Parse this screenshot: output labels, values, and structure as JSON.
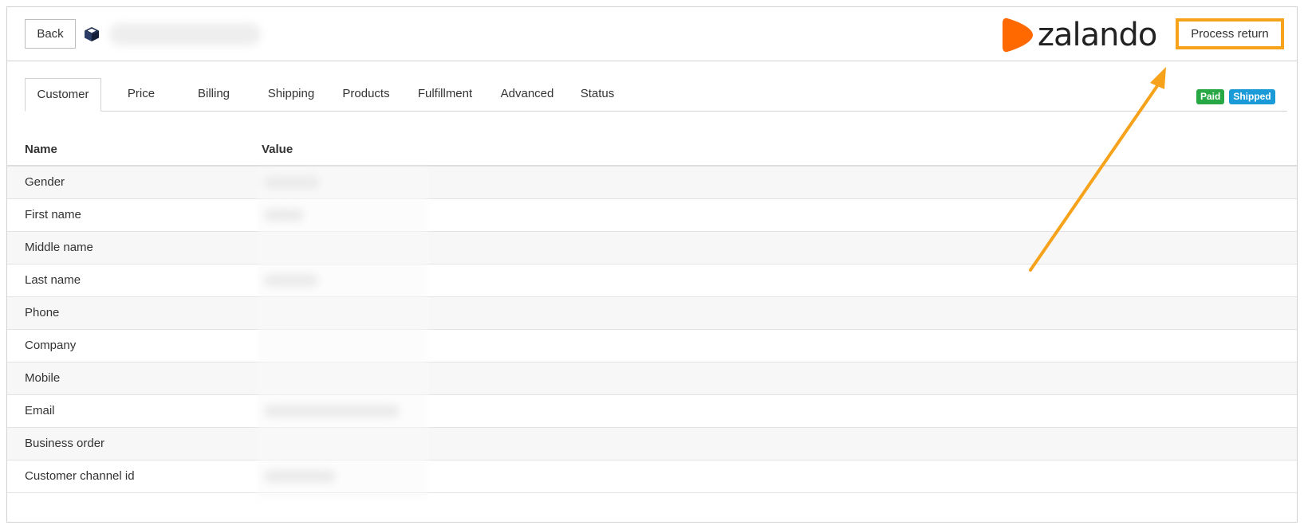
{
  "header": {
    "back_label": "Back",
    "brand_name": "zalando",
    "process_return_label": "Process return"
  },
  "tabs": [
    {
      "label": "Customer",
      "active": true
    },
    {
      "label": "Price"
    },
    {
      "label": "Billing"
    },
    {
      "label": "Shipping"
    },
    {
      "label": "Products"
    },
    {
      "label": "Fulfillment"
    },
    {
      "label": "Advanced"
    },
    {
      "label": "Status"
    }
  ],
  "badges": {
    "paid": {
      "label": "Paid",
      "color": "#27a844"
    },
    "shipped": {
      "label": "Shipped",
      "color": "#1a9bd7"
    }
  },
  "table": {
    "headers": {
      "name": "Name",
      "value": "Value"
    },
    "rows": [
      {
        "name": "Gender"
      },
      {
        "name": "First name"
      },
      {
        "name": "Middle name"
      },
      {
        "name": "Last name"
      },
      {
        "name": "Phone"
      },
      {
        "name": "Company"
      },
      {
        "name": "Mobile"
      },
      {
        "name": "Email"
      },
      {
        "name": "Business order"
      },
      {
        "name": "Customer channel id"
      }
    ]
  },
  "colors": {
    "annotation_orange": "#f7a21b",
    "brand_orange": "#ff6900"
  },
  "icons": {
    "box": "package-icon"
  }
}
